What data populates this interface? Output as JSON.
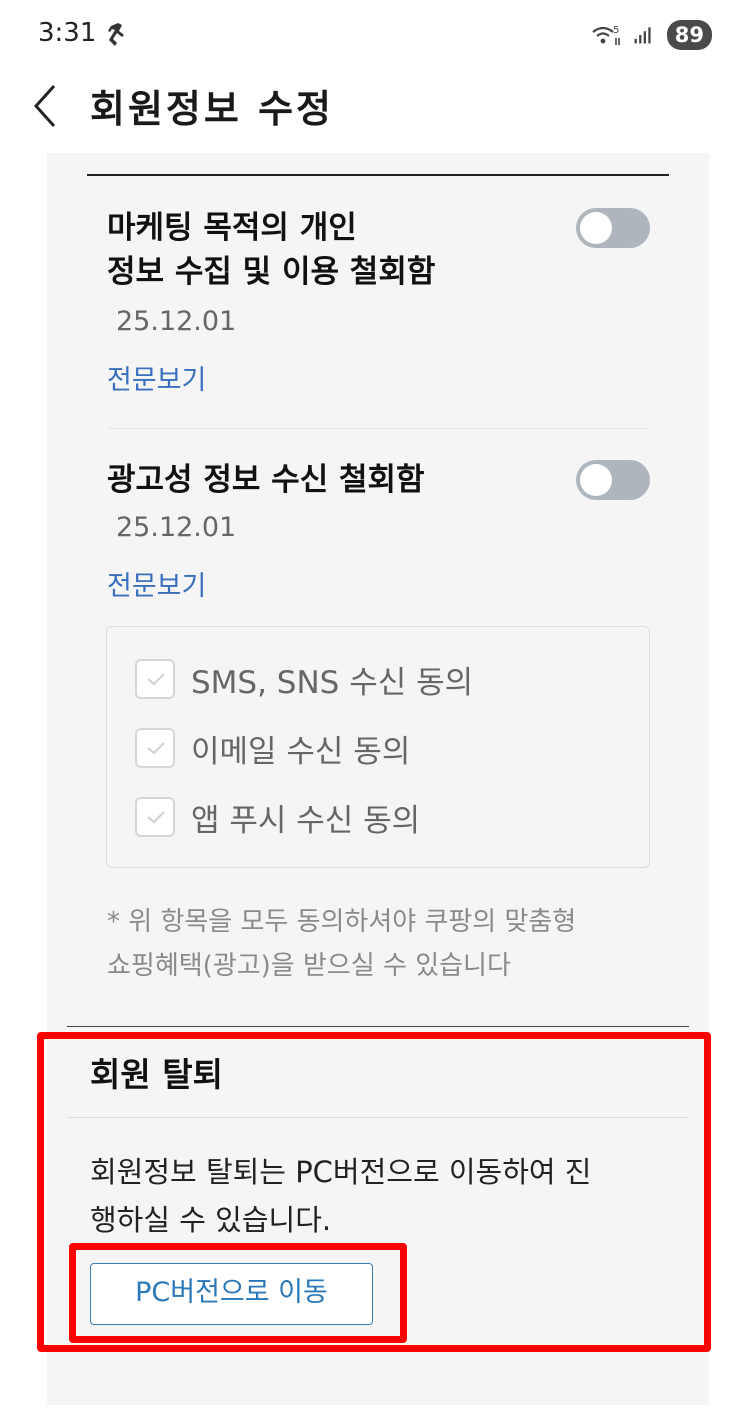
{
  "status_bar": {
    "time": "3:31",
    "battery": "89",
    "icons": [
      "runner-icon",
      "wifi-icon",
      "signal-icon",
      "battery-icon"
    ]
  },
  "header": {
    "title": "회원정보 수정",
    "back_icon": "chevron-left-icon"
  },
  "consents": [
    {
      "title_line1": "마케팅 목적의 개인",
      "title_line2": "정보 수집 및 이용 철회함",
      "date": "25.12.01",
      "link": "전문보기",
      "toggle_on": false
    },
    {
      "title_line1": "광고성 정보 수신 철회함",
      "date": "25.12.01",
      "link": "전문보기",
      "toggle_on": false
    }
  ],
  "channels": [
    {
      "label": "SMS, SNS 수신 동의",
      "checked": true
    },
    {
      "label": "이메일 수신 동의",
      "checked": true
    },
    {
      "label": "앱 푸시 수신 동의",
      "checked": true
    }
  ],
  "notice": {
    "line1": "* 위 항목을 모두 동의하셔야 쿠팡의 맞춤형",
    "line2": "쇼핑혜택(광고)을 받으실 수 있습니다"
  },
  "withdraw": {
    "title": "회원 탈퇴",
    "desc_line1": "회원정보 탈퇴는 PC버전으로 이동하여 진",
    "desc_line2": "행하실 수 있습니다.",
    "button_label": "PC버전으로 이동"
  },
  "colors": {
    "highlight": "#ff0000",
    "link": "#3a6fbf",
    "toggle_off": "#aeb5bd",
    "button_text": "#2a78b8"
  }
}
